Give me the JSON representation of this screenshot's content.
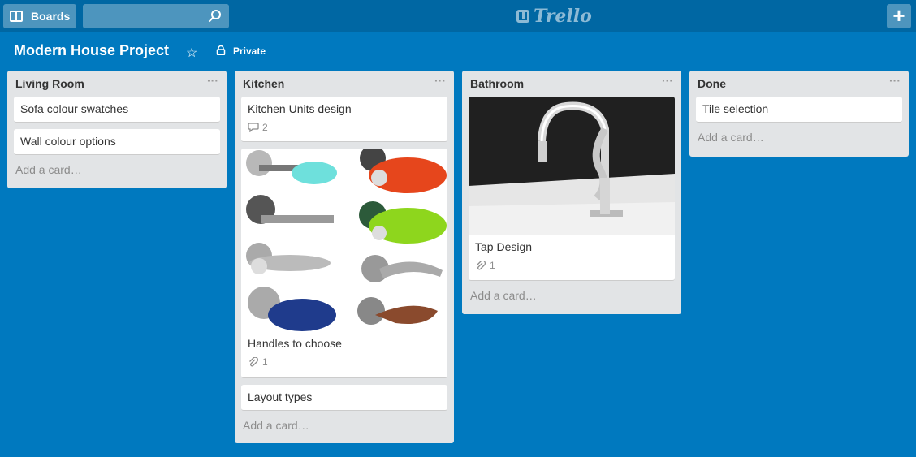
{
  "header": {
    "boards_label": "Boards",
    "search_placeholder": "",
    "logo_text": "Trello",
    "add_label": "+"
  },
  "board": {
    "title": "Modern House Project",
    "privacy": "Private"
  },
  "lists": [
    {
      "title": "Living Room",
      "menu": "···",
      "cards": [
        {
          "title": "Sofa colour swatches"
        },
        {
          "title": "Wall colour options"
        }
      ],
      "add_card": "Add a card…"
    },
    {
      "title": "Kitchen",
      "menu": "···",
      "cards": [
        {
          "title": "Kitchen Units design",
          "comments": "2"
        },
        {
          "title": "Handles to choose",
          "attachments": "1",
          "cover": "door-handles"
        },
        {
          "title": "Layout types"
        }
      ],
      "add_card": "Add a card…"
    },
    {
      "title": "Bathroom",
      "menu": "···",
      "cards": [
        {
          "title": "Tap Design",
          "attachments": "1",
          "cover": "chrome-tap"
        }
      ],
      "add_card": "Add a card…"
    },
    {
      "title": "Done",
      "menu": "···",
      "cards": [
        {
          "title": "Tile selection"
        }
      ],
      "add_card": "Add a card…"
    }
  ],
  "colors": {
    "background": "#0079bf",
    "header": "#0067a3",
    "list": "#e2e4e6"
  }
}
